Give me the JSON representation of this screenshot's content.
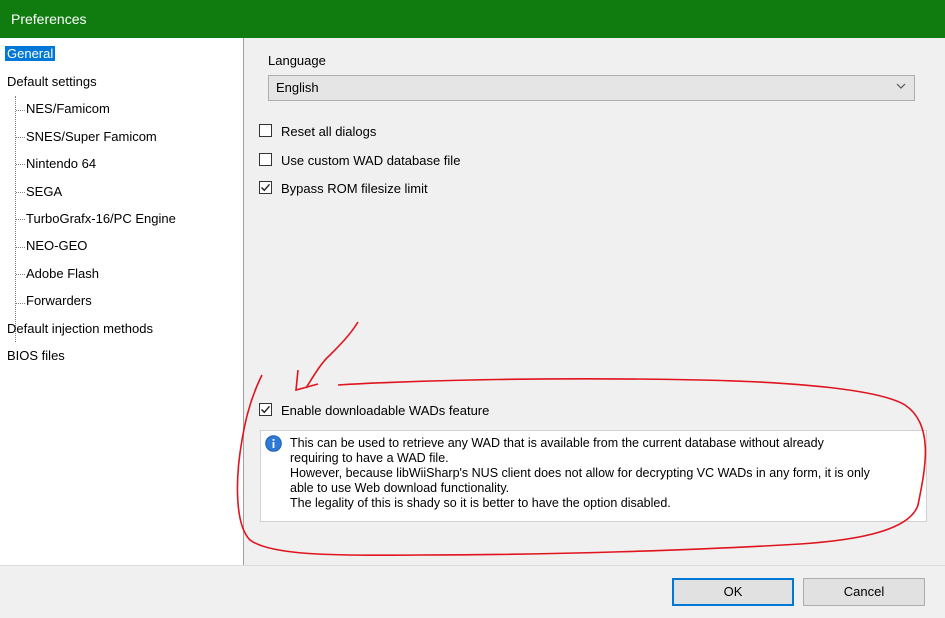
{
  "window": {
    "title": "Preferences"
  },
  "sidebar": {
    "items": [
      {
        "label": "General",
        "selected": true
      },
      {
        "label": "Default settings"
      },
      {
        "label": "NES/Famicom"
      },
      {
        "label": "SNES/Super Famicom"
      },
      {
        "label": "Nintendo 64"
      },
      {
        "label": "SEGA"
      },
      {
        "label": "TurboGrafx-16/PC Engine"
      },
      {
        "label": "NEO-GEO"
      },
      {
        "label": "Adobe Flash"
      },
      {
        "label": "Forwarders"
      },
      {
        "label": "Default injection methods"
      },
      {
        "label": "BIOS files"
      }
    ]
  },
  "general": {
    "language_label": "Language",
    "language_value": "English",
    "checkboxes": [
      {
        "label": "Reset all dialogs",
        "checked": false
      },
      {
        "label": "Use custom WAD database file",
        "checked": false
      },
      {
        "label": "Bypass ROM filesize limit",
        "checked": true
      },
      {
        "label": "Enable downloadable WADs feature",
        "checked": true
      }
    ],
    "info_lines": [
      "This can be used to retrieve any WAD that is available from the current database without already",
      "requiring to have a WAD file.",
      "However, because libWiiSharp's NUS client does not allow for decrypting VC WADs in any form, it is only",
      "able to use Web download functionality.",
      "The legality of this is shady so it is better to have the option disabled."
    ]
  },
  "buttons": {
    "ok": "OK",
    "cancel": "Cancel"
  },
  "colors": {
    "titlebar": "#107c10",
    "selection": "#0078d7",
    "annotation": "#e0141e"
  }
}
